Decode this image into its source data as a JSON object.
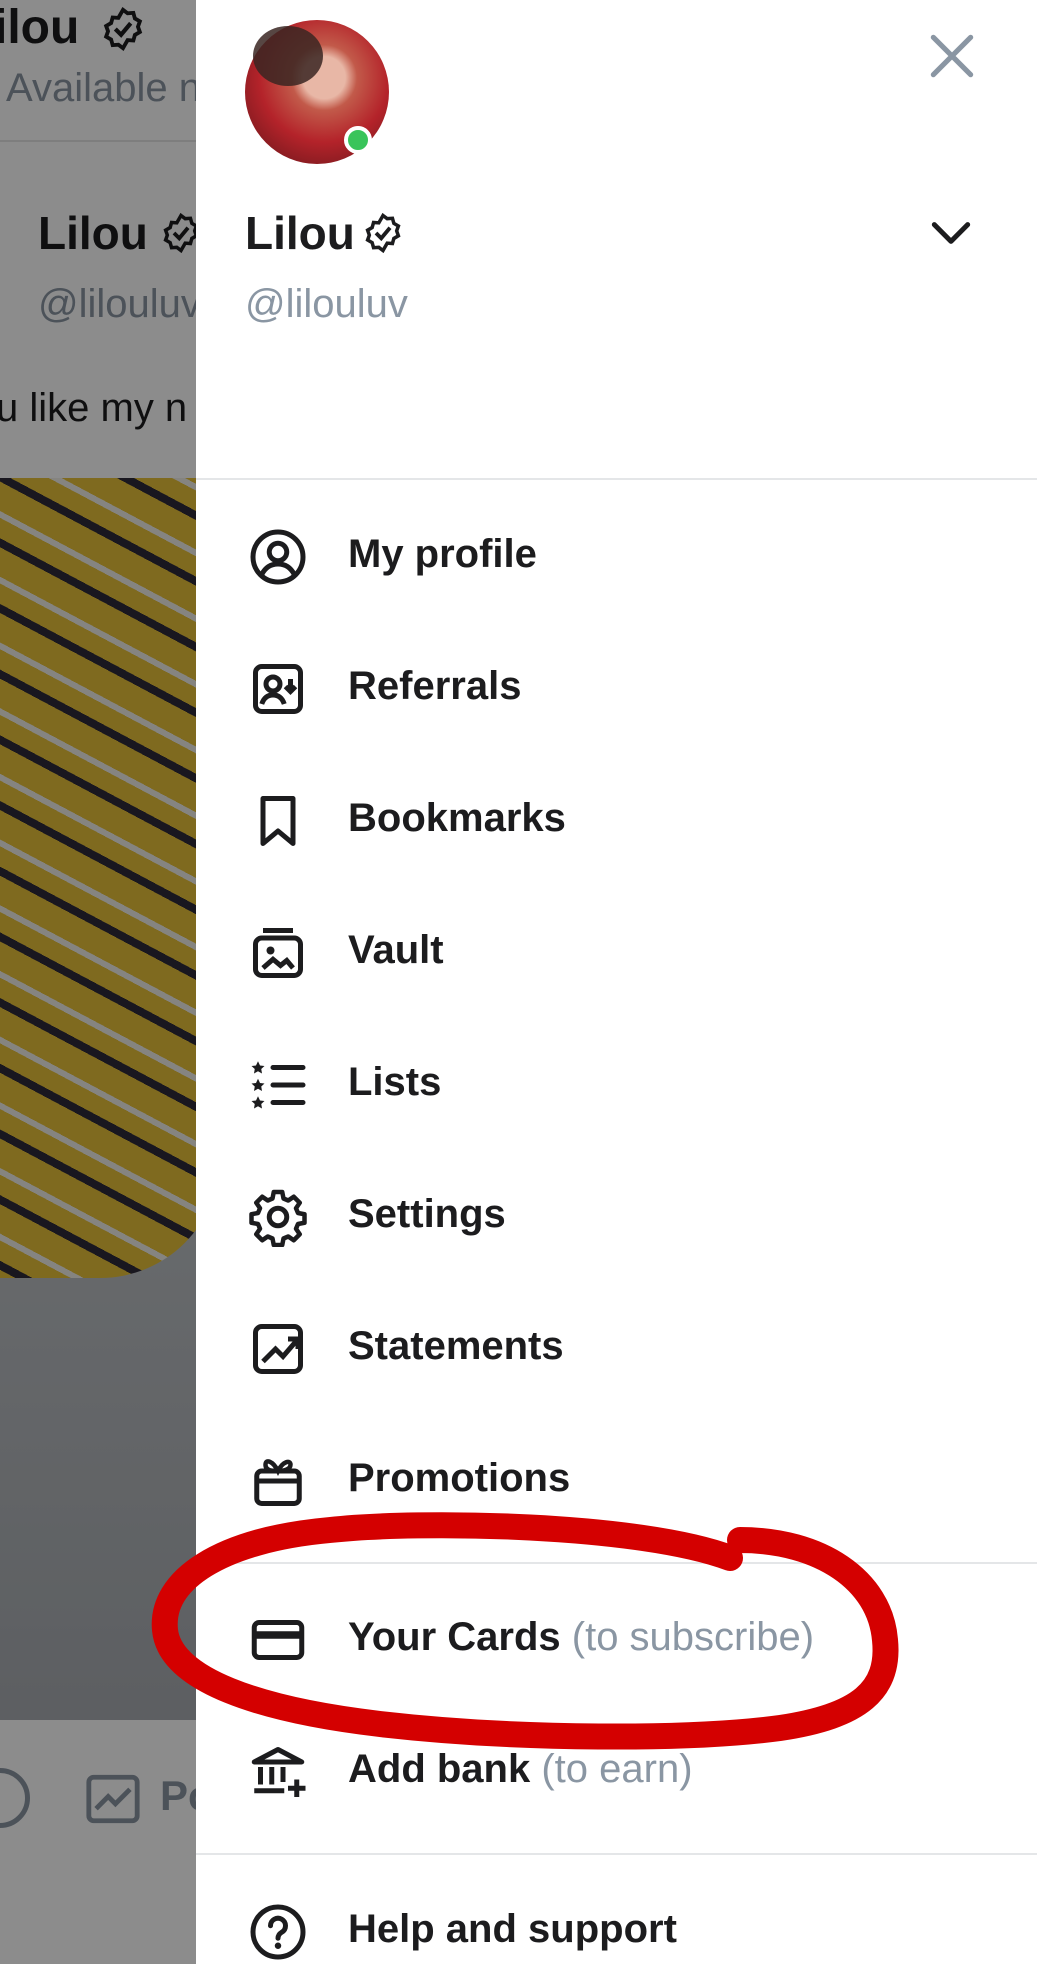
{
  "background_page": {
    "name_top": "ilou",
    "available_text": "Available n",
    "name": "Lilou",
    "handle": "@lilouluv",
    "caption": "u like my n",
    "stats_text": "Po"
  },
  "drawer": {
    "profile": {
      "name": "Lilou",
      "handle": "@lilouluv",
      "online_color": "#39c45a"
    },
    "menu": [
      {
        "label": "My profile",
        "icon": "user-circle-icon"
      },
      {
        "label": "Referrals",
        "icon": "referrals-icon"
      },
      {
        "label": "Bookmarks",
        "icon": "bookmark-icon"
      },
      {
        "label": "Vault",
        "icon": "vault-image-icon"
      },
      {
        "label": "Lists",
        "icon": "star-list-icon"
      },
      {
        "label": "Settings",
        "icon": "gear-icon"
      },
      {
        "label": "Statements",
        "icon": "chart-trend-icon"
      },
      {
        "label": "Promotions",
        "icon": "gift-icon"
      },
      {
        "label": "Your Cards",
        "sub": "(to subscribe)",
        "icon": "credit-card-icon"
      },
      {
        "label": "Add bank",
        "sub": "(to earn)",
        "icon": "bank-add-icon"
      },
      {
        "label": "Help and support",
        "icon": "help-circle-icon"
      }
    ]
  },
  "colors": {
    "text_primary": "#1c1c1e",
    "text_muted": "#8a96a3",
    "annotation_red": "#d40000"
  }
}
